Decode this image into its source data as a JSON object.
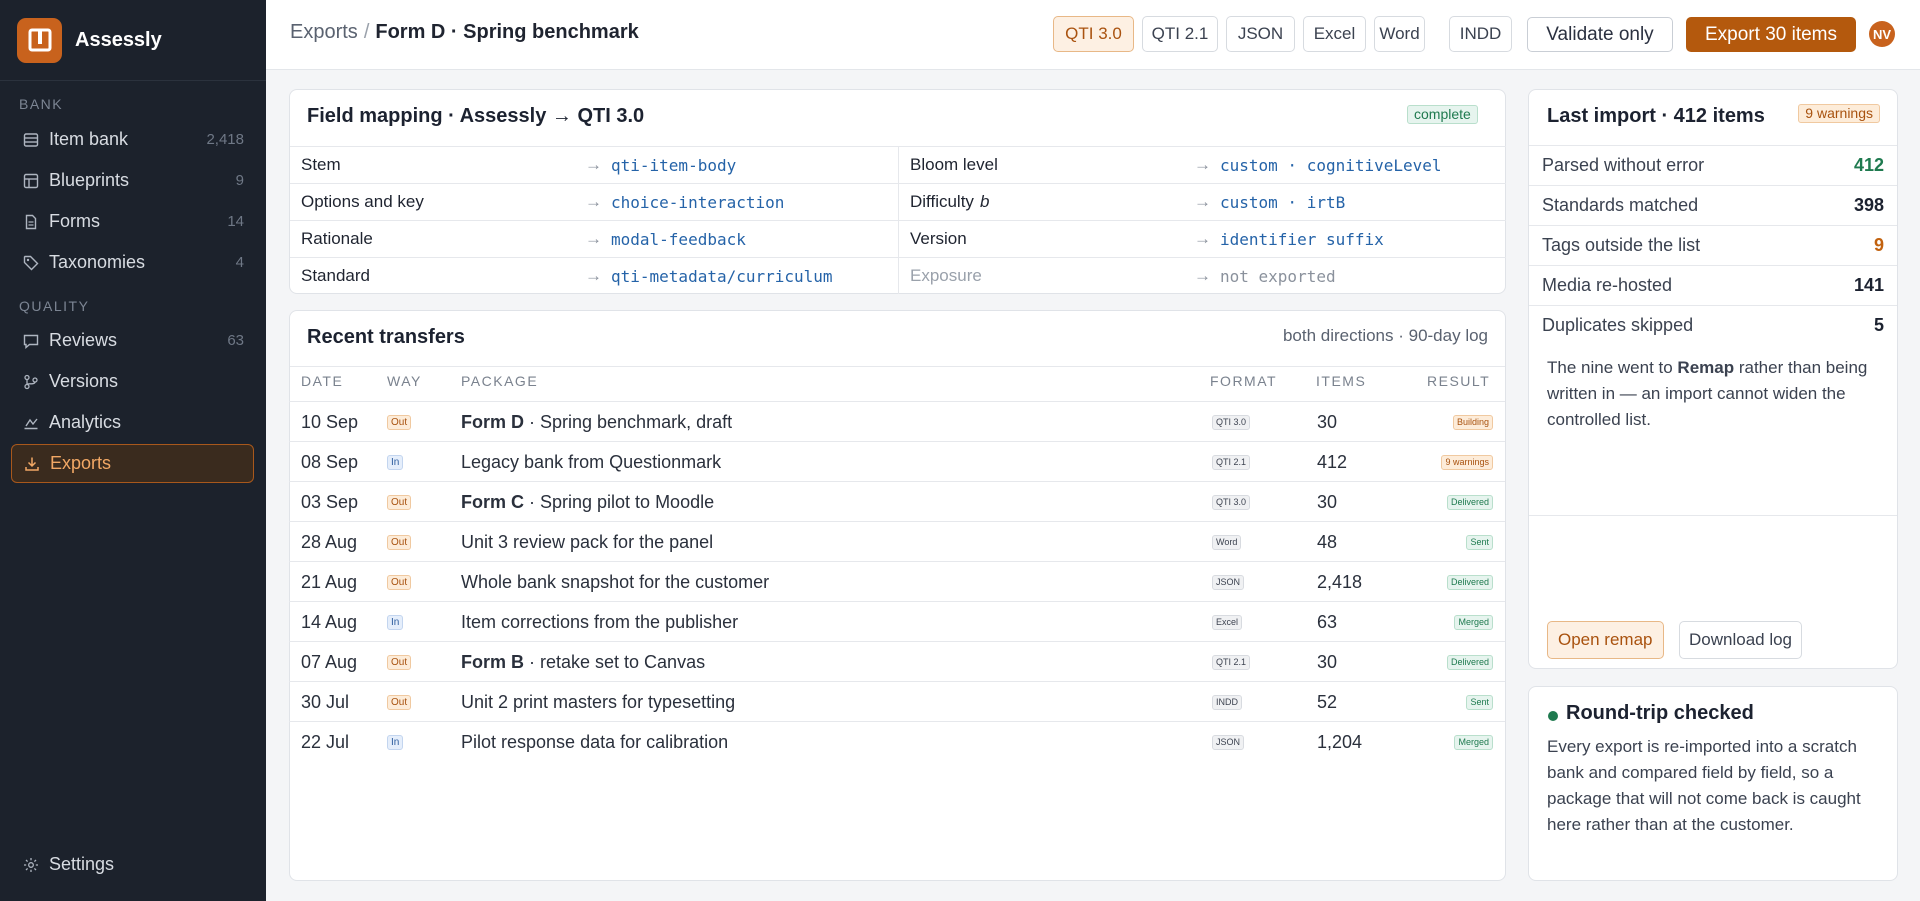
{
  "app": {
    "name": "Assessly",
    "user_initials": "NV"
  },
  "sidebar": {
    "sections": [
      {
        "label": "BANK"
      },
      {
        "label": "QUALITY"
      }
    ],
    "items": [
      {
        "label": "Item bank",
        "count": "2,418",
        "icon": "list-icon"
      },
      {
        "label": "Blueprints",
        "count": "9",
        "icon": "grid-icon"
      },
      {
        "label": "Forms",
        "count": "14",
        "icon": "document-icon"
      },
      {
        "label": "Taxonomies",
        "count": "4",
        "icon": "tag-icon"
      },
      {
        "label": "Reviews",
        "count": "63",
        "icon": "comment-icon"
      },
      {
        "label": "Versions",
        "count": "",
        "icon": "branch-icon"
      },
      {
        "label": "Analytics",
        "count": "",
        "icon": "chart-icon"
      },
      {
        "label": "Exports",
        "count": "",
        "icon": "download-icon",
        "active": true
      }
    ],
    "settings_label": "Settings"
  },
  "header": {
    "breadcrumb_root": "Exports",
    "breadcrumb_sep": "/",
    "breadcrumb_current": "Form D · Spring benchmark",
    "formats": [
      "QTI 3.0",
      "QTI 2.1",
      "JSON",
      "Excel",
      "Word",
      "INDD"
    ],
    "active_format": "QTI 3.0",
    "validate_label": "Validate only",
    "export_label": "Export 30 items"
  },
  "mapping": {
    "title": "Field mapping · Assessly → QTI 3.0",
    "status": "complete",
    "arrow": "→",
    "left": [
      {
        "field": "Stem",
        "target": "qti-item-body"
      },
      {
        "field": "Options and key",
        "target": "choice-interaction"
      },
      {
        "field": "Rationale",
        "target": "modal-feedback"
      },
      {
        "field": "Standard",
        "target": "qti-metadata/curriculum"
      }
    ],
    "right": [
      {
        "field": "Bloom level",
        "field_var": "",
        "target": "custom · cognitiveLevel"
      },
      {
        "field": "Difficulty",
        "field_var": "b",
        "target": "custom · irtB"
      },
      {
        "field": "Version",
        "field_var": "",
        "target": "identifier suffix"
      },
      {
        "field": "Exposure",
        "field_var": "",
        "target": "not exported",
        "muted": true
      }
    ]
  },
  "transfers": {
    "title": "Recent transfers",
    "subtitle": "both directions · 90-day log",
    "columns": [
      "DATE",
      "WAY",
      "PACKAGE",
      "FORMAT",
      "ITEMS",
      "RESULT"
    ],
    "rows": [
      {
        "date": "10 Sep",
        "way": "Out",
        "pkg_bold": "Form D",
        "pkg_rest": " · Spring benchmark, draft",
        "format": "QTI 3.0",
        "items": "30",
        "result": "Building",
        "result_tone": "orange"
      },
      {
        "date": "08 Sep",
        "way": "In",
        "pkg_bold": "",
        "pkg_rest": "Legacy bank from Questionmark",
        "format": "QTI 2.1",
        "items": "412",
        "result": "9 warnings",
        "result_tone": "orange"
      },
      {
        "date": "03 Sep",
        "way": "Out",
        "pkg_bold": "Form C",
        "pkg_rest": " · Spring pilot to Moodle",
        "format": "QTI 3.0",
        "items": "30",
        "result": "Delivered",
        "result_tone": "green"
      },
      {
        "date": "28 Aug",
        "way": "Out",
        "pkg_bold": "",
        "pkg_rest": "Unit 3 review pack for the panel",
        "format": "Word",
        "items": "48",
        "result": "Sent",
        "result_tone": "green"
      },
      {
        "date": "21 Aug",
        "way": "Out",
        "pkg_bold": "",
        "pkg_rest": "Whole bank snapshot for the customer",
        "format": "JSON",
        "items": "2,418",
        "result": "Delivered",
        "result_tone": "green"
      },
      {
        "date": "14 Aug",
        "way": "In",
        "pkg_bold": "",
        "pkg_rest": "Item corrections from the publisher",
        "format": "Excel",
        "items": "63",
        "result": "Merged",
        "result_tone": "green"
      },
      {
        "date": "07 Aug",
        "way": "Out",
        "pkg_bold": "Form B",
        "pkg_rest": " · retake set to Canvas",
        "format": "QTI 2.1",
        "items": "30",
        "result": "Delivered",
        "result_tone": "green"
      },
      {
        "date": "30 Jul",
        "way": "Out",
        "pkg_bold": "",
        "pkg_rest": "Unit 2 print masters for typesetting",
        "format": "INDD",
        "items": "52",
        "result": "Sent",
        "result_tone": "green"
      },
      {
        "date": "22 Jul",
        "way": "In",
        "pkg_bold": "",
        "pkg_rest": "Pilot response data for calibration",
        "format": "JSON",
        "items": "1,204",
        "result": "Merged",
        "result_tone": "green"
      }
    ]
  },
  "last_import": {
    "title": "Last import · 412 items",
    "badge": "9 warnings",
    "stats": [
      {
        "label": "Parsed without error",
        "value": "412",
        "tone": "green"
      },
      {
        "label": "Standards matched",
        "value": "398",
        "tone": "default"
      },
      {
        "label": "Tags outside the list",
        "value": "9",
        "tone": "orange"
      },
      {
        "label": "Media re-hosted",
        "value": "141",
        "tone": "default"
      },
      {
        "label": "Duplicates skipped",
        "value": "5",
        "tone": "default"
      }
    ],
    "note_pre": "The nine went to ",
    "note_bold": "Remap",
    "note_post": " rather than being written in — an import cannot widen the controlled list.",
    "open_remap_label": "Open remap",
    "download_log_label": "Download log"
  },
  "roundtrip": {
    "title": "Round-trip checked",
    "body": "Every export is re-imported into a scratch bank and compared field by field, so a package that will not come back is caught here rather than at the customer."
  },
  "colors": {
    "accent": "#b4590d",
    "sidebar_bg": "#1c222c",
    "green": "#1f7a4f",
    "orange": "#c2620f"
  }
}
